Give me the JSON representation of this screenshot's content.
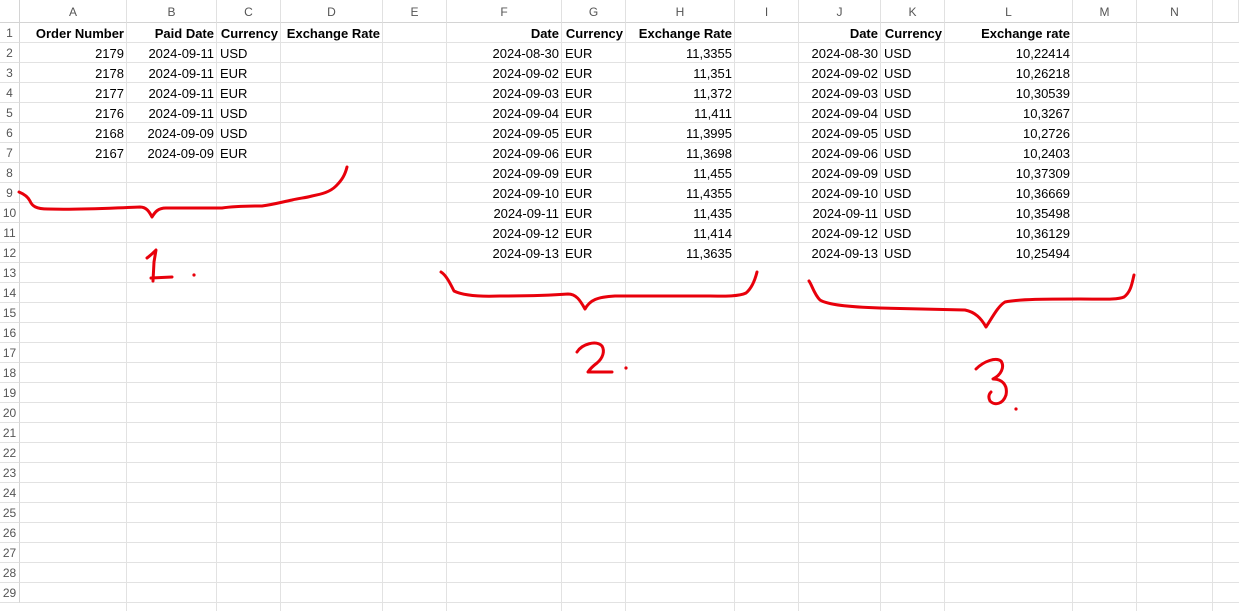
{
  "columns": [
    "A",
    "B",
    "C",
    "D",
    "E",
    "F",
    "G",
    "H",
    "I",
    "J",
    "K",
    "L",
    "M",
    "N"
  ],
  "rows": [
    "1",
    "2",
    "3",
    "4",
    "5",
    "6",
    "7",
    "8",
    "9",
    "10",
    "11",
    "12",
    "13",
    "14",
    "15",
    "16",
    "17",
    "18",
    "19",
    "20",
    "21",
    "22",
    "23",
    "24",
    "25",
    "26",
    "27",
    "28",
    "29"
  ],
  "table1": {
    "headers": [
      "Order Number",
      "Paid Date",
      "Currency",
      "Exchange Rate"
    ],
    "rows": [
      [
        "2179",
        "2024-09-11",
        "USD",
        ""
      ],
      [
        "2178",
        "2024-09-11",
        "EUR",
        ""
      ],
      [
        "2177",
        "2024-09-11",
        "EUR",
        ""
      ],
      [
        "2176",
        "2024-09-11",
        "USD",
        ""
      ],
      [
        "2168",
        "2024-09-09",
        "USD",
        ""
      ],
      [
        "2167",
        "2024-09-09",
        "EUR",
        ""
      ]
    ]
  },
  "table2": {
    "headers": [
      "Date",
      "Currency",
      "Exchange Rate"
    ],
    "rows": [
      [
        "2024-08-30",
        "EUR",
        "11,3355"
      ],
      [
        "2024-09-02",
        "EUR",
        "11,351"
      ],
      [
        "2024-09-03",
        "EUR",
        "11,372"
      ],
      [
        "2024-09-04",
        "EUR",
        "11,411"
      ],
      [
        "2024-09-05",
        "EUR",
        "11,3995"
      ],
      [
        "2024-09-06",
        "EUR",
        "11,3698"
      ],
      [
        "2024-09-09",
        "EUR",
        "11,455"
      ],
      [
        "2024-09-10",
        "EUR",
        "11,4355"
      ],
      [
        "2024-09-11",
        "EUR",
        "11,435"
      ],
      [
        "2024-09-12",
        "EUR",
        "11,414"
      ],
      [
        "2024-09-13",
        "EUR",
        "11,3635"
      ]
    ]
  },
  "table3": {
    "headers": [
      "Date",
      "Currency",
      "Exchange rate"
    ],
    "rows": [
      [
        "2024-08-30",
        "USD",
        "10,22414"
      ],
      [
        "2024-09-02",
        "USD",
        "10,26218"
      ],
      [
        "2024-09-03",
        "USD",
        "10,30539"
      ],
      [
        "2024-09-04",
        "USD",
        "10,3267"
      ],
      [
        "2024-09-05",
        "USD",
        "10,2726"
      ],
      [
        "2024-09-06",
        "USD",
        "10,2403"
      ],
      [
        "2024-09-09",
        "USD",
        "10,37309"
      ],
      [
        "2024-09-10",
        "USD",
        "10,36669"
      ],
      [
        "2024-09-11",
        "USD",
        "10,35498"
      ],
      [
        "2024-09-12",
        "USD",
        "10,36129"
      ],
      [
        "2024-09-13",
        "USD",
        "10,25494"
      ]
    ]
  },
  "annotations": {
    "ink_color": "#e8000b",
    "labels": [
      "1.",
      "2.",
      "3."
    ]
  }
}
